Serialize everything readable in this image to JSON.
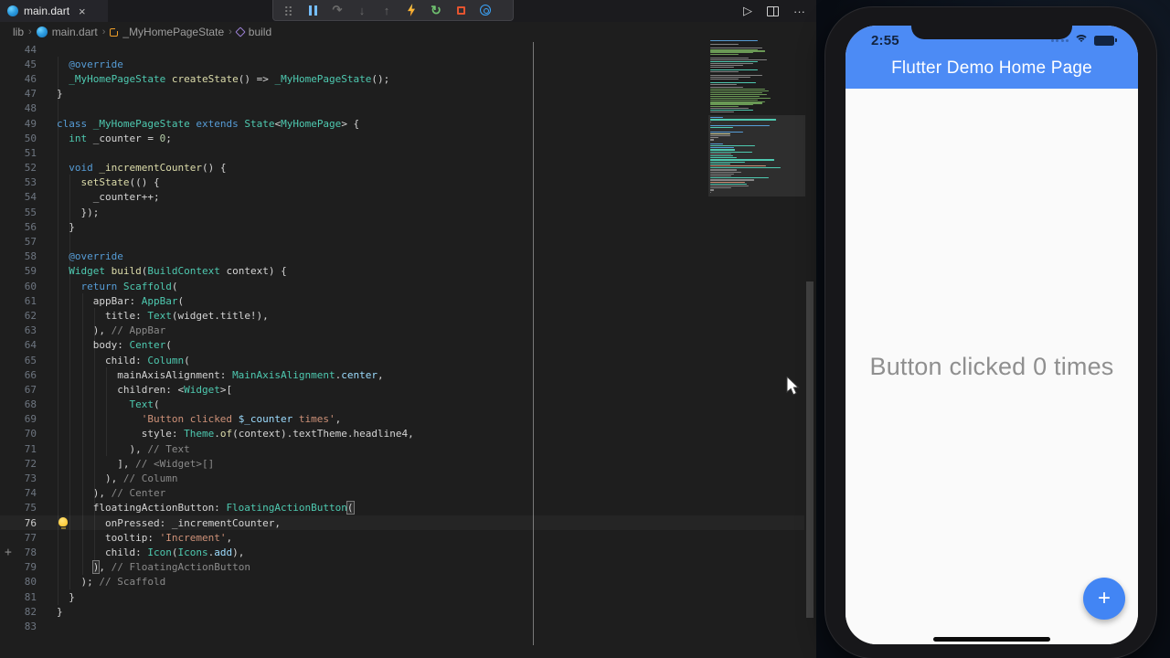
{
  "tab_bar": {
    "tabs": [
      {
        "label": "main.dart",
        "close_glyph": "×"
      }
    ],
    "actions": {
      "run_glyph": "▷",
      "more_glyph": "···"
    }
  },
  "debug_toolbar": {
    "items": [
      "drag-handle",
      "pause",
      "step-over",
      "step-into",
      "step-out",
      "hot-reload",
      "restart",
      "stop",
      "open-devtools-inspector"
    ]
  },
  "breadcrumb": {
    "items": [
      "lib",
      "main.dart",
      "_MyHomePageState",
      "build"
    ]
  },
  "editor": {
    "ruler_column": 80,
    "gutter_plus_glyph": "+",
    "code_lines": [
      {
        "n": 44,
        "s": []
      },
      {
        "n": 45,
        "s": [
          [
            "kw",
            "  @override"
          ]
        ]
      },
      {
        "n": 46,
        "s": [
          [
            "ty",
            "  _MyHomePageState"
          ],
          [
            "tx",
            " "
          ],
          [
            "fn",
            "createState"
          ],
          [
            "tx",
            "() => "
          ],
          [
            "ty",
            "_MyHomePageState"
          ],
          [
            "tx",
            "();"
          ]
        ]
      },
      {
        "n": 47,
        "s": [
          [
            "tx",
            "}"
          ]
        ]
      },
      {
        "n": 48,
        "s": []
      },
      {
        "n": 49,
        "s": [
          [
            "kw",
            "class"
          ],
          [
            "tx",
            " "
          ],
          [
            "ty",
            "_MyHomePageState"
          ],
          [
            "tx",
            " "
          ],
          [
            "kw",
            "extends"
          ],
          [
            "tx",
            " "
          ],
          [
            "ty",
            "State"
          ],
          [
            "tx",
            "<"
          ],
          [
            "ty",
            "MyHomePage"
          ],
          [
            "tx",
            "> {"
          ]
        ]
      },
      {
        "n": 50,
        "s": [
          [
            "ty",
            "  int"
          ],
          [
            "tx",
            " _counter = "
          ],
          [
            "nm",
            "0"
          ],
          [
            "tx",
            ";"
          ]
        ]
      },
      {
        "n": 51,
        "s": []
      },
      {
        "n": 52,
        "s": [
          [
            "kw",
            "  void"
          ],
          [
            "tx",
            " "
          ],
          [
            "fn",
            "_incrementCounter"
          ],
          [
            "tx",
            "() {"
          ]
        ]
      },
      {
        "n": 53,
        "s": [
          [
            "tx",
            "    "
          ],
          [
            "fn",
            "setState"
          ],
          [
            "tx",
            "(() {"
          ]
        ]
      },
      {
        "n": 54,
        "s": [
          [
            "tx",
            "      _counter++;"
          ]
        ]
      },
      {
        "n": 55,
        "s": [
          [
            "tx",
            "    });"
          ]
        ]
      },
      {
        "n": 56,
        "s": [
          [
            "tx",
            "  }"
          ]
        ]
      },
      {
        "n": 57,
        "s": []
      },
      {
        "n": 58,
        "s": [
          [
            "kw",
            "  @override"
          ]
        ]
      },
      {
        "n": 59,
        "s": [
          [
            "ty",
            "  Widget"
          ],
          [
            "tx",
            " "
          ],
          [
            "fn",
            "build"
          ],
          [
            "tx",
            "("
          ],
          [
            "ty",
            "BuildContext"
          ],
          [
            "tx",
            " context) {"
          ]
        ]
      },
      {
        "n": 60,
        "s": [
          [
            "kw",
            "    return"
          ],
          [
            "tx",
            " "
          ],
          [
            "ty",
            "Scaffold"
          ],
          [
            "tx",
            "("
          ]
        ]
      },
      {
        "n": 61,
        "s": [
          [
            "tx",
            "      appBar: "
          ],
          [
            "ty",
            "AppBar"
          ],
          [
            "tx",
            "("
          ]
        ]
      },
      {
        "n": 62,
        "s": [
          [
            "tx",
            "        title: "
          ],
          [
            "ty",
            "Text"
          ],
          [
            "tx",
            "(widget.title!),"
          ]
        ]
      },
      {
        "n": 63,
        "s": [
          [
            "tx",
            "      ), "
          ],
          [
            "cm",
            "// AppBar"
          ]
        ]
      },
      {
        "n": 64,
        "s": [
          [
            "tx",
            "      body: "
          ],
          [
            "ty",
            "Center"
          ],
          [
            "tx",
            "("
          ]
        ]
      },
      {
        "n": 65,
        "s": [
          [
            "tx",
            "        child: "
          ],
          [
            "ty",
            "Column"
          ],
          [
            "tx",
            "("
          ]
        ]
      },
      {
        "n": 66,
        "s": [
          [
            "tx",
            "          mainAxisAlignment: "
          ],
          [
            "ty",
            "MainAxisAlignment"
          ],
          [
            "tx",
            "."
          ],
          [
            "pr",
            "center"
          ],
          [
            "tx",
            ","
          ]
        ]
      },
      {
        "n": 67,
        "s": [
          [
            "tx",
            "          children: <"
          ],
          [
            "ty",
            "Widget"
          ],
          [
            "tx",
            ">["
          ]
        ]
      },
      {
        "n": 68,
        "s": [
          [
            "tx",
            "            "
          ],
          [
            "ty",
            "Text"
          ],
          [
            "tx",
            "("
          ]
        ]
      },
      {
        "n": 69,
        "s": [
          [
            "tx",
            "              "
          ],
          [
            "st",
            "'Button clicked "
          ],
          [
            "pr",
            "$_counter"
          ],
          [
            "st",
            " times'"
          ],
          [
            "tx",
            ","
          ]
        ]
      },
      {
        "n": 70,
        "s": [
          [
            "tx",
            "              style: "
          ],
          [
            "ty",
            "Theme"
          ],
          [
            "tx",
            "."
          ],
          [
            "fn",
            "of"
          ],
          [
            "tx",
            "(context).textTheme.headline4,"
          ]
        ]
      },
      {
        "n": 71,
        "s": [
          [
            "tx",
            "            ), "
          ],
          [
            "cm",
            "// Text"
          ]
        ]
      },
      {
        "n": 72,
        "s": [
          [
            "tx",
            "          ], "
          ],
          [
            "cm",
            "// <Widget>[]"
          ]
        ]
      },
      {
        "n": 73,
        "s": [
          [
            "tx",
            "        ), "
          ],
          [
            "cm",
            "// Column"
          ]
        ]
      },
      {
        "n": 74,
        "s": [
          [
            "tx",
            "      ), "
          ],
          [
            "cm",
            "// Center"
          ]
        ]
      },
      {
        "n": 75,
        "s": [
          [
            "tx",
            "      floatingActionButton: "
          ],
          [
            "ty",
            "FloatingActionButton"
          ],
          [
            "bm",
            "("
          ]
        ]
      },
      {
        "n": 76,
        "cur": 1,
        "s": [
          [
            "tx",
            "        onPressed: _incrementCounter,"
          ]
        ]
      },
      {
        "n": 77,
        "s": [
          [
            "tx",
            "        tooltip: "
          ],
          [
            "st",
            "'Increment'"
          ],
          [
            "tx",
            ","
          ]
        ]
      },
      {
        "n": 78,
        "s": [
          [
            "tx",
            "        child: "
          ],
          [
            "ty",
            "Icon"
          ],
          [
            "tx",
            "("
          ],
          [
            "ty",
            "Icons"
          ],
          [
            "tx",
            "."
          ],
          [
            "pr",
            "add"
          ],
          [
            "tx",
            "),"
          ]
        ]
      },
      {
        "n": 79,
        "s": [
          [
            "tx",
            "      "
          ],
          [
            "bm",
            ")"
          ],
          [
            "tx",
            ", "
          ],
          [
            "cm",
            "// FloatingActionButton"
          ]
        ]
      },
      {
        "n": 80,
        "s": [
          [
            "tx",
            "    ); "
          ],
          [
            "cm",
            "// Scaffold"
          ]
        ]
      },
      {
        "n": 81,
        "s": [
          [
            "tx",
            "  }"
          ]
        ]
      },
      {
        "n": 82,
        "s": [
          [
            "tx",
            "}"
          ]
        ]
      },
      {
        "n": 83,
        "s": []
      }
    ]
  },
  "minimap": {
    "upper": [
      [
        "b",
        0.5
      ],
      null,
      [
        "w",
        0.3
      ],
      null,
      [
        "w",
        0.55
      ],
      [
        "g",
        0.5
      ],
      [
        "g",
        0.58
      ],
      [
        "g",
        0.45
      ],
      [
        "g",
        0.3
      ],
      null,
      [
        "w",
        0.4
      ],
      [
        "w",
        0.6
      ],
      [
        "t",
        0.5
      ],
      [
        "w",
        0.45
      ],
      [
        "w",
        0.35
      ],
      [
        "w",
        0.25
      ],
      null,
      [
        "t",
        0.5
      ],
      [
        "w",
        0.3
      ],
      null,
      [
        "w",
        0.55
      ],
      [
        "w",
        0.42
      ],
      [
        "w",
        0.3
      ],
      null,
      [
        "t",
        0.48
      ],
      [
        "w",
        0.28
      ],
      null,
      [
        "w",
        0.35
      ],
      [
        "g",
        0.58
      ],
      [
        "g",
        0.62
      ],
      [
        "g",
        0.55
      ],
      [
        "g",
        0.6
      ],
      [
        "g",
        0.52
      ],
      [
        "g",
        0.63
      ],
      [
        "g",
        0.5
      ],
      [
        "g",
        0.58
      ],
      [
        "g",
        0.55
      ],
      [
        "g",
        0.45
      ],
      [
        "g",
        0.3
      ],
      [
        "w",
        0.4
      ],
      [
        "t",
        0.45
      ],
      [
        "w",
        0.25
      ],
      null
    ]
  },
  "device": {
    "status": {
      "time": "2:55",
      "icons": [
        "cellular-dots",
        "wifi",
        "battery"
      ]
    },
    "app_bar": {
      "title": "Flutter Demo Home Page",
      "color": "#4C8BF5"
    },
    "body": {
      "counter_text": "Button clicked 0 times",
      "text_color": "#8F8F8F",
      "background": "#FAFAFA"
    },
    "fab": {
      "glyph": "+",
      "color": "#4285F4"
    }
  }
}
